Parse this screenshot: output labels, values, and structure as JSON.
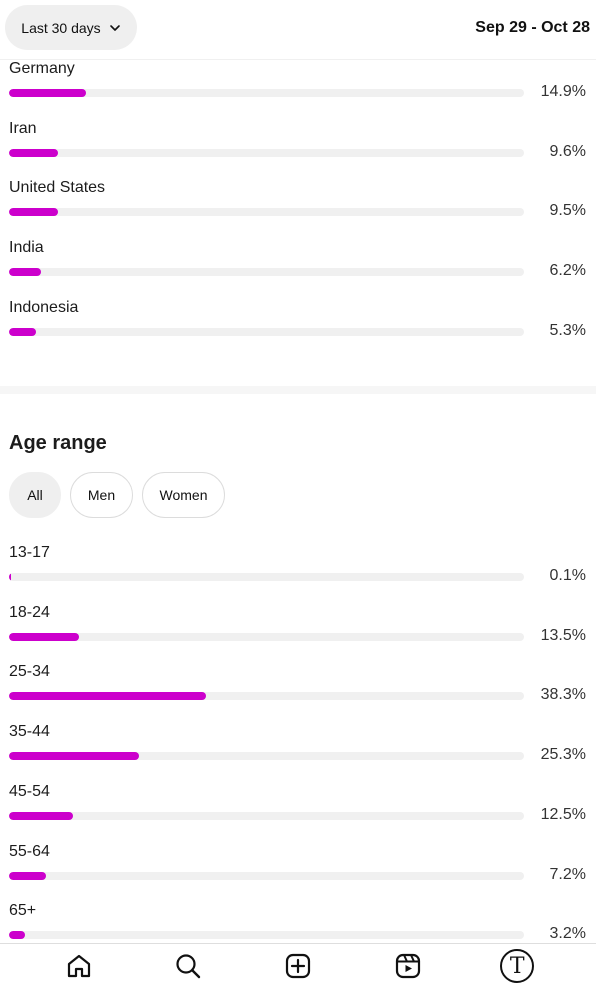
{
  "header": {
    "range_label": "Last 30 days",
    "date_range": "Sep 29 - Oct 28"
  },
  "countries": [
    {
      "label": "Germany",
      "value": "14.9%",
      "fraction": 0.149
    },
    {
      "label": "Iran",
      "value": "9.6%",
      "fraction": 0.096
    },
    {
      "label": "United States",
      "value": "9.5%",
      "fraction": 0.095
    },
    {
      "label": "India",
      "value": "6.2%",
      "fraction": 0.062
    },
    {
      "label": "Indonesia",
      "value": "5.3%",
      "fraction": 0.053
    }
  ],
  "age_section": {
    "title": "Age range",
    "tabs": [
      "All",
      "Men",
      "Women"
    ],
    "active_tab": "All"
  },
  "ages": [
    {
      "label": "13-17",
      "value": "0.1%",
      "fraction": 0.001
    },
    {
      "label": "18-24",
      "value": "13.5%",
      "fraction": 0.135
    },
    {
      "label": "25-34",
      "value": "38.3%",
      "fraction": 0.383
    },
    {
      "label": "35-44",
      "value": "25.3%",
      "fraction": 0.253
    },
    {
      "label": "45-54",
      "value": "12.5%",
      "fraction": 0.125
    },
    {
      "label": "55-64",
      "value": "7.2%",
      "fraction": 0.072
    },
    {
      "label": "65+",
      "value": "3.2%",
      "fraction": 0.032
    }
  ],
  "colors": {
    "bar_fill": "#cc00cc",
    "bar_track": "#f0f0f0"
  },
  "nav": {
    "items": [
      "home-icon",
      "search-icon",
      "create-icon",
      "reels-icon",
      "profile-avatar"
    ],
    "avatar_letter": "T"
  }
}
